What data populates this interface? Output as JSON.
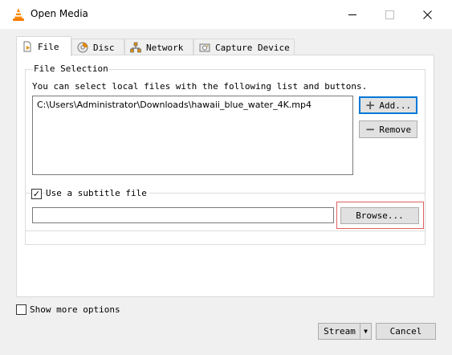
{
  "window": {
    "title": "Open Media",
    "icon": "vlc-cone-icon"
  },
  "tabs": [
    {
      "label": "File",
      "icon": "file-icon",
      "active": true
    },
    {
      "label": "Disc",
      "icon": "disc-icon",
      "active": false
    },
    {
      "label": "Network",
      "icon": "network-icon",
      "active": false
    },
    {
      "label": "Capture Device",
      "icon": "capture-device-icon",
      "active": false
    }
  ],
  "file_selection": {
    "group_title": "File Selection",
    "helper_text": "You can select local files with the following list and buttons.",
    "files": [
      "C:\\Users\\Administrator\\Downloads\\hawaii_blue_water_4K.mp4"
    ],
    "add_label": "Add...",
    "remove_label": "Remove"
  },
  "subtitle": {
    "checkbox_label": "Use a subtitle file",
    "checked": true,
    "input_value": "",
    "browse_label": "Browse..."
  },
  "options": {
    "show_more_label": "Show more options",
    "checked": false
  },
  "footer": {
    "stream_label": "Stream",
    "cancel_label": "Cancel"
  },
  "colors": {
    "accent": "#0078d7",
    "highlight": "#e06060",
    "vlc_orange": "#ff8800"
  }
}
